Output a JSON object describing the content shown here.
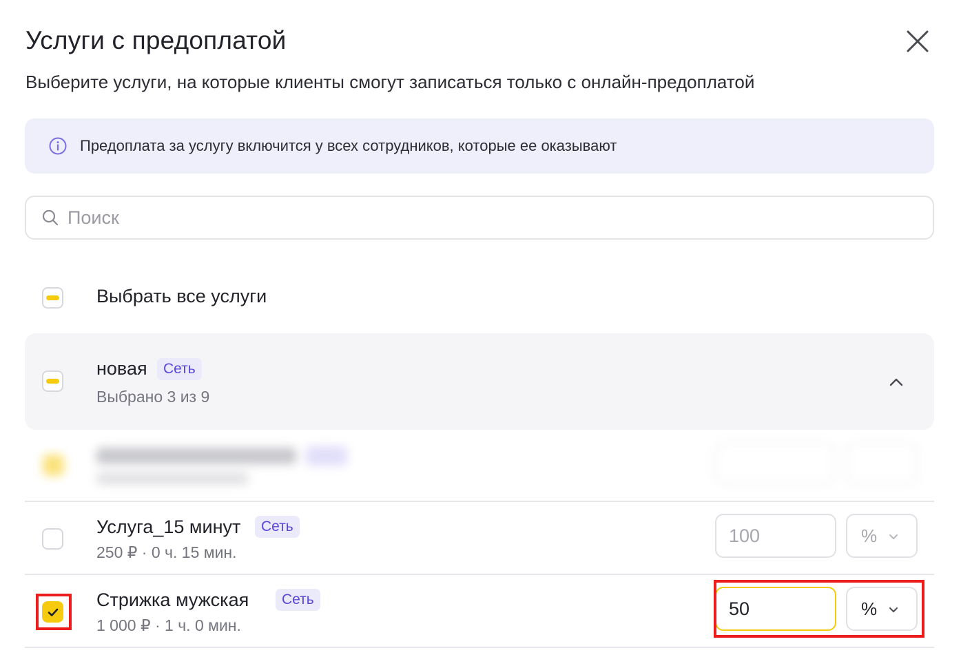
{
  "modal": {
    "title": "Услуги с предоплатой",
    "subtitle": "Выберите услуги, на которые клиенты смогут записаться только с онлайн-предоплатой",
    "info_text": "Предоплата за услугу включится у всех сотрудников, которые ее оказывают"
  },
  "search": {
    "placeholder": "Поиск",
    "value": ""
  },
  "select_all": {
    "label": "Выбрать все услуги",
    "state": "indeterminate"
  },
  "group": {
    "name": "новая",
    "badge": "Сеть",
    "selected_text": "Выбрано 3 из 9",
    "state": "indeterminate",
    "expanded": true
  },
  "services": [
    {
      "name": "Услуга_15 минут",
      "badge": "Сеть",
      "meta": "250 ₽ · 0 ч. 15 мин.",
      "checked": false,
      "amount": "100",
      "unit": "%",
      "disabled": true
    },
    {
      "name": "Стрижка мужская",
      "badge": "Сеть",
      "meta": "1 000 ₽ · 1 ч. 0 мин.",
      "checked": true,
      "amount": "50",
      "unit": "%",
      "disabled": false
    }
  ],
  "colors": {
    "accent": "#f6cb0e",
    "badge_bg": "#ebeafb",
    "badge_text": "#5a46dc",
    "info_bg": "#efeefb",
    "highlight": "#ee1d1d"
  },
  "icons": {
    "close": "close-icon",
    "info": "info-icon",
    "search": "search-icon",
    "collapse": "chevron-up-icon",
    "unit_dropdown": "chevron-down-icon",
    "check": "check-icon"
  }
}
